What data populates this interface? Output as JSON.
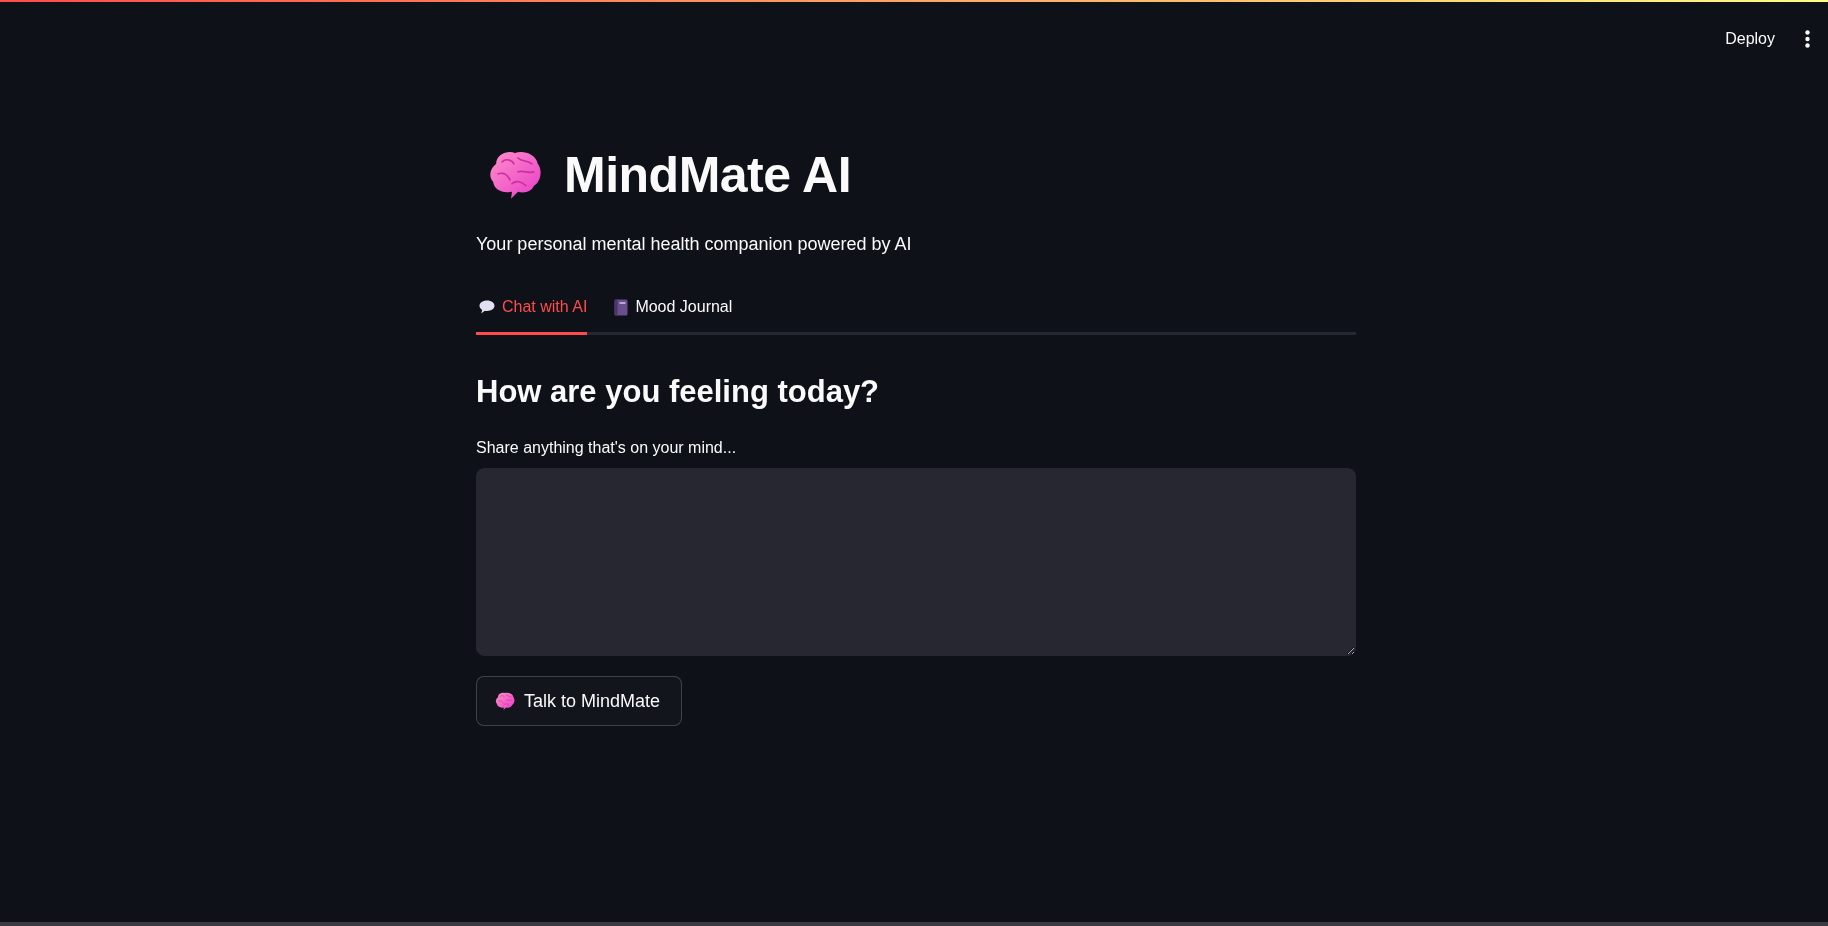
{
  "header": {
    "deploy_button": "Deploy"
  },
  "title": "MindMate AI",
  "subtitle": "Your personal mental health companion powered by AI",
  "tabs": [
    {
      "label": "Chat with AI",
      "selected": true
    },
    {
      "label": "Mood Journal",
      "selected": false
    }
  ],
  "chat": {
    "heading": "How are you feeling today?",
    "field_label": "Share anything that's on your mind...",
    "submit_button": "Talk to MindMate"
  }
}
